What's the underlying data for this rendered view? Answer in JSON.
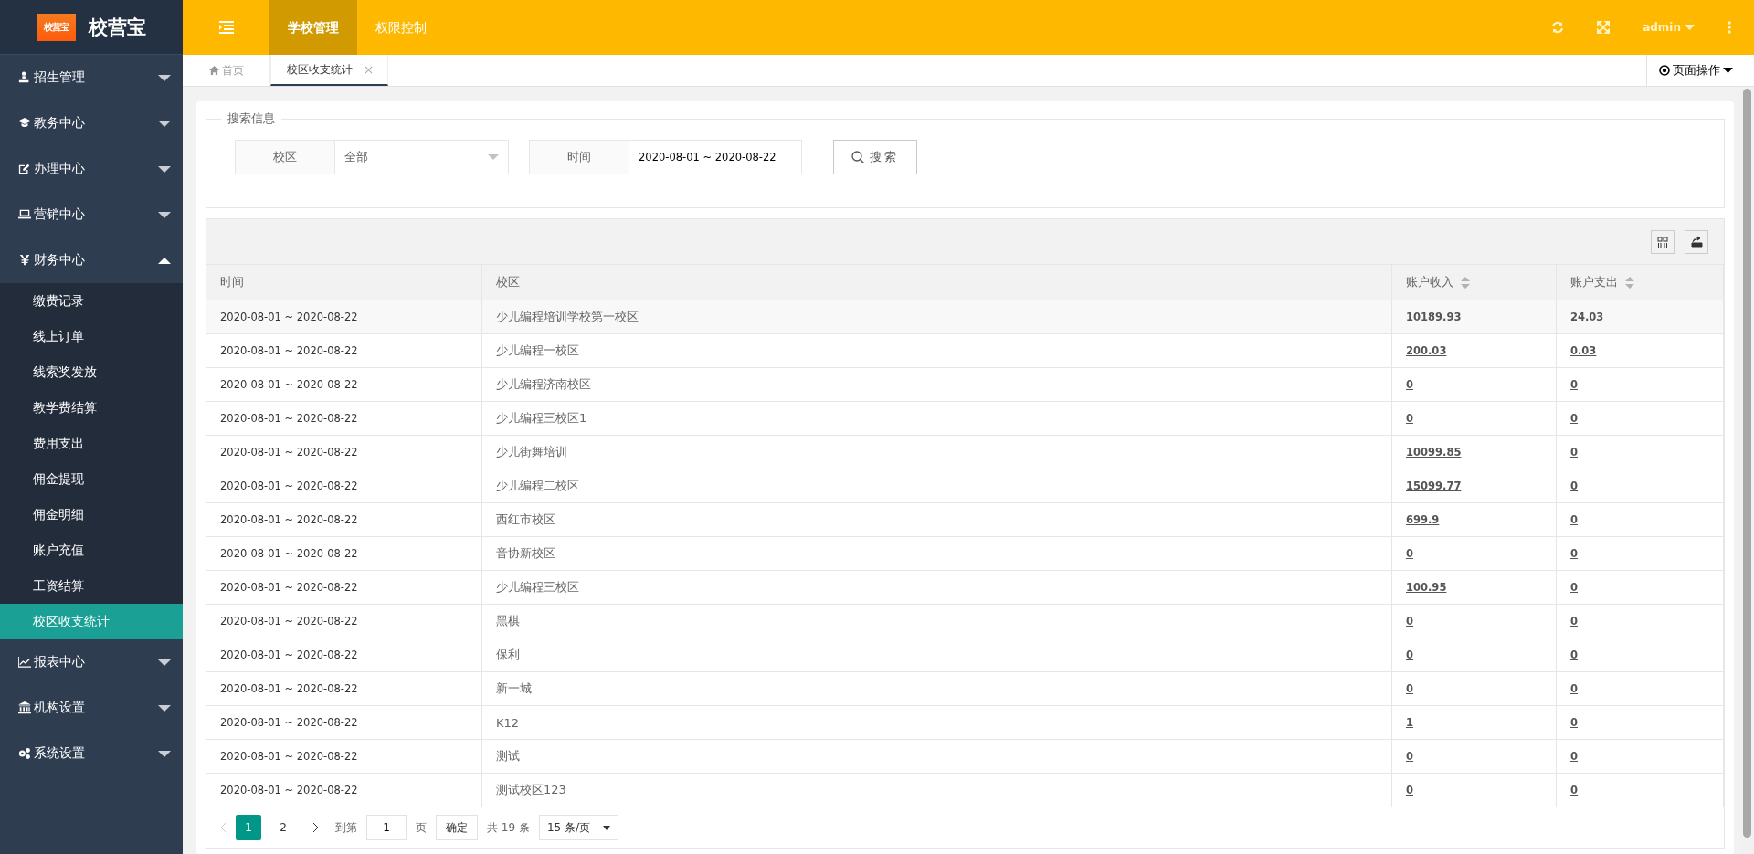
{
  "header": {
    "logo_badge": "校营宝",
    "logo_text": "校营宝",
    "nav": [
      {
        "label": "学校管理",
        "selected": true
      },
      {
        "label": "权限控制",
        "selected": false
      }
    ],
    "user": "admin"
  },
  "sidebar": {
    "items": [
      {
        "label": "招生管理",
        "expanded": false
      },
      {
        "label": "教务中心",
        "expanded": false
      },
      {
        "label": "办理中心",
        "expanded": false
      },
      {
        "label": "营销中心",
        "expanded": false
      },
      {
        "label": "财务中心",
        "expanded": true,
        "children": [
          {
            "label": "缴费记录",
            "selected": false
          },
          {
            "label": "线上订单",
            "selected": false
          },
          {
            "label": "线索奖发放",
            "selected": false
          },
          {
            "label": "教学费结算",
            "selected": false
          },
          {
            "label": "费用支出",
            "selected": false
          },
          {
            "label": "佣金提现",
            "selected": false
          },
          {
            "label": "佣金明细",
            "selected": false
          },
          {
            "label": "账户充值",
            "selected": false
          },
          {
            "label": "工资结算",
            "selected": false
          },
          {
            "label": "校区收支统计",
            "selected": true
          }
        ]
      },
      {
        "label": "报表中心",
        "expanded": false
      },
      {
        "label": "机构设置",
        "expanded": false
      },
      {
        "label": "系统设置",
        "expanded": false
      }
    ]
  },
  "tabs": [
    {
      "label": "首页",
      "selected": false,
      "kind": "home"
    },
    {
      "label": "校区收支统计",
      "selected": true,
      "kind": "closable"
    }
  ],
  "page_actions": "页面操作",
  "search": {
    "legend": "搜索信息",
    "fields": [
      {
        "label": "校区",
        "value": "全部",
        "kind": "select"
      },
      {
        "label": "时间",
        "value": "2020-08-01 ~ 2020-08-22",
        "kind": "text"
      }
    ],
    "button": "搜索"
  },
  "table": {
    "columns": [
      {
        "label": "时间",
        "sortable": false
      },
      {
        "label": "校区",
        "sortable": false
      },
      {
        "label": "账户收入",
        "sortable": true
      },
      {
        "label": "账户支出",
        "sortable": true
      }
    ],
    "rows": [
      [
        "2020-08-01 ~ 2020-08-22",
        "少儿编程培训学校第一校区",
        "10189.93",
        "24.03"
      ],
      [
        "2020-08-01 ~ 2020-08-22",
        "少儿编程一校区",
        "200.03",
        "0.03"
      ],
      [
        "2020-08-01 ~ 2020-08-22",
        "少儿编程济南校区",
        "0",
        "0"
      ],
      [
        "2020-08-01 ~ 2020-08-22",
        "少儿编程三校区1",
        "0",
        "0"
      ],
      [
        "2020-08-01 ~ 2020-08-22",
        "少儿街舞培训",
        "10099.85",
        "0"
      ],
      [
        "2020-08-01 ~ 2020-08-22",
        "少儿编程二校区",
        "15099.77",
        "0"
      ],
      [
        "2020-08-01 ~ 2020-08-22",
        "西红市校区",
        "699.9",
        "0"
      ],
      [
        "2020-08-01 ~ 2020-08-22",
        "音协新校区",
        "0",
        "0"
      ],
      [
        "2020-08-01 ~ 2020-08-22",
        "少儿编程三校区",
        "100.95",
        "0"
      ],
      [
        "2020-08-01 ~ 2020-08-22",
        "黑棋",
        "0",
        "0"
      ],
      [
        "2020-08-01 ~ 2020-08-22",
        "保利",
        "0",
        "0"
      ],
      [
        "2020-08-01 ~ 2020-08-22",
        "新一城",
        "0",
        "0"
      ],
      [
        "2020-08-01 ~ 2020-08-22",
        "K12",
        "1",
        "0"
      ],
      [
        "2020-08-01 ~ 2020-08-22",
        "测试",
        "0",
        "0"
      ],
      [
        "2020-08-01 ~ 2020-08-22",
        "测试校区123",
        "0",
        "0"
      ]
    ]
  },
  "pagination": {
    "pages": [
      {
        "label": "1",
        "selected": true
      },
      {
        "label": "2",
        "selected": false
      }
    ],
    "goto_label": "到第",
    "goto_value": "1",
    "page_unit": "页",
    "confirm": "确定",
    "total": "共 19 条",
    "page_size": "15 条/页"
  }
}
